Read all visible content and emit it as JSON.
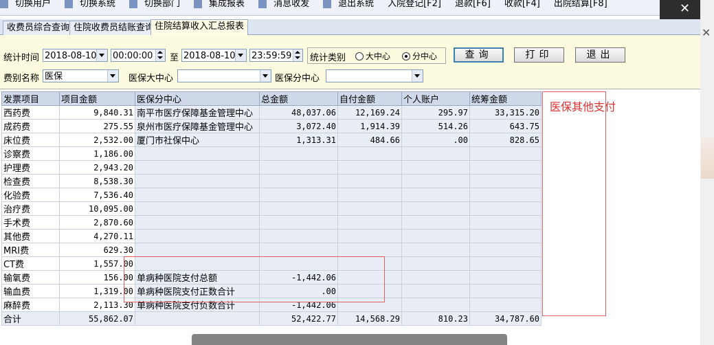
{
  "menubar": {
    "items": [
      "切换用户",
      "切换系统",
      "切换部门",
      "集成报表",
      "消息收发",
      "退出系统",
      "入院登记[F2]",
      "退款[F6]",
      "收款[F4]",
      "出院结算[F8]"
    ]
  },
  "tabs": [
    {
      "label": "收费员综合查询",
      "active": false
    },
    {
      "label": "住院收费员结账查询",
      "active": false
    },
    {
      "label": "住院结算收入汇总报表",
      "active": true
    }
  ],
  "filters": {
    "time_label": "统计时间",
    "start_date": "2018-08-10",
    "start_time": "00:00:00",
    "to_label": "至",
    "end_date": "2018-08-10",
    "end_time": "23:59:59",
    "category_label": "统计类别",
    "category_options": [
      "大中心",
      "分中心"
    ],
    "category_selected": "分中心",
    "fee_label": "费别名称",
    "fee_value": "医保",
    "center_label": "医保大中心",
    "center_value": "",
    "subcenter_label": "医保分中心",
    "subcenter_value": ""
  },
  "buttons": {
    "query": "查询",
    "print": "打印",
    "exit": "退出"
  },
  "table": {
    "headers": [
      "发票项目",
      "项目金额",
      "医保分中心",
      "总金额",
      "自付金额",
      "个人账户",
      "统筹金额"
    ],
    "rows": [
      [
        "西药费",
        "9,840.31",
        "南平市医疗保障基金管理中心",
        "48,037.06",
        "12,169.24",
        "295.97",
        "33,315.20"
      ],
      [
        "成药费",
        "275.55",
        "泉州市医疗保障基金管理中心",
        "3,072.40",
        "1,914.39",
        "514.26",
        "643.75"
      ],
      [
        "床位费",
        "2,532.00",
        "厦门市社保中心",
        "1,313.31",
        "484.66",
        ".00",
        "828.65"
      ],
      [
        "诊察费",
        "1,186.00",
        "",
        "",
        "",
        "",
        ""
      ],
      [
        "护理费",
        "2,943.20",
        "",
        "",
        "",
        "",
        ""
      ],
      [
        "检查费",
        "8,538.30",
        "",
        "",
        "",
        "",
        ""
      ],
      [
        "化验费",
        "7,536.40",
        "",
        "",
        "",
        "",
        ""
      ],
      [
        "治疗费",
        "10,095.00",
        "",
        "",
        "",
        "",
        ""
      ],
      [
        "手术费",
        "2,870.60",
        "",
        "",
        "",
        "",
        ""
      ],
      [
        "其他费",
        "4,270.11",
        "",
        "",
        "",
        "",
        ""
      ],
      [
        "MRI费",
        "629.30",
        "",
        "",
        "",
        "",
        ""
      ],
      [
        "CT费",
        "1,557.00",
        "",
        "",
        "",
        "",
        ""
      ],
      [
        "输氧费",
        "156.00",
        "单病种医院支付总额",
        "-1,442.06",
        "",
        "",
        ""
      ],
      [
        "输血费",
        "1,319.00",
        "单病种医院支付正数合计",
        ".00",
        "",
        "",
        ""
      ],
      [
        "麻醉费",
        "2,113.30",
        "单病种医院支付负数合计",
        "-1,442.06",
        "",
        "",
        ""
      ]
    ],
    "total": [
      "合计",
      "55,862.07",
      "",
      "52,422.77",
      "14,568.29",
      "810.23",
      "34,787.60"
    ]
  },
  "annotation": {
    "text": "医保其他支付"
  },
  "colors": {
    "filter_bg": "#fdfbdf",
    "header_bg": "#cfd9ea",
    "alt_row": "#e8edf6",
    "annotation_red": "#e03030"
  }
}
